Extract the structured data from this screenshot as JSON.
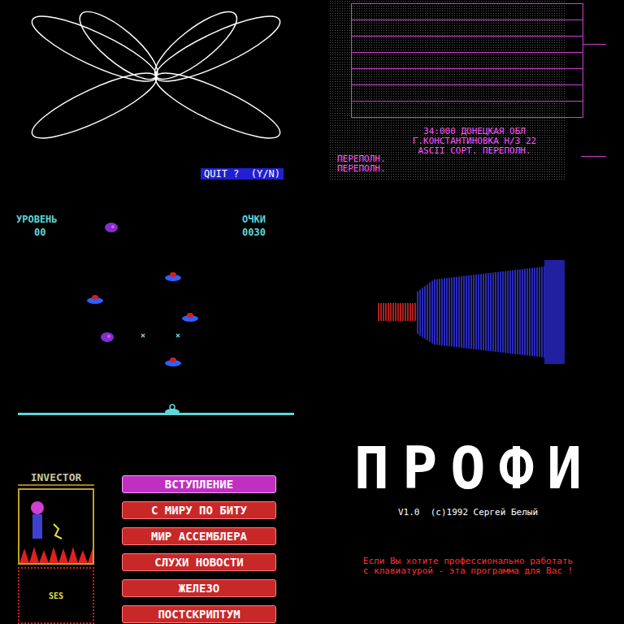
{
  "quit_dialog": {
    "prompt": "QUIT ?  (Y/N)"
  },
  "sheet": {
    "lines": [
      "34:000 ДОНЕЦКАЯ ОБЛ",
      "Г.КОНСТАНТИНОВКА Н/З 22",
      "ASCII СОРТ. ПЕРЕПОЛН."
    ],
    "messages": [
      "ПЕРЕПОЛН.",
      "ПЕРЕПОЛН."
    ]
  },
  "game": {
    "level_label": "УРОВЕНЬ",
    "level": "00",
    "score_label": "ОЧКИ",
    "score": "0030"
  },
  "magazine": {
    "logo": "INVECTOR",
    "badge": "SES",
    "menu": [
      {
        "label": "ВСТУПЛЕНИЕ",
        "selected": true
      },
      {
        "label": "С МИРУ ПО БИТУ",
        "selected": false
      },
      {
        "label": "МИР АССЕМБЛЕРА",
        "selected": false
      },
      {
        "label": "СЛУХИ НОВОСТИ",
        "selected": false
      },
      {
        "label": "ЖЕЛЕЗО",
        "selected": false
      },
      {
        "label": "ПОСТСКРИПТУМ",
        "selected": false
      }
    ]
  },
  "profi": {
    "title": "ПРОФИ",
    "version": "V1.0  (c)1992 Сергей Белый",
    "tagline": "Если Вы хотите профессионально работать с клавиатурой - эта программа для Вас !"
  }
}
